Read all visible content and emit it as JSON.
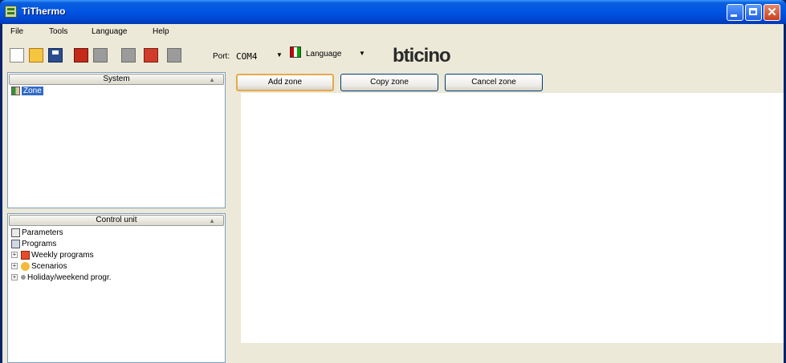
{
  "window": {
    "title": "TiThermo"
  },
  "menu": {
    "items": [
      "File",
      "Tools",
      "Language",
      "Help"
    ]
  },
  "toolbar": {
    "port_label": "Port:",
    "port_value": "COM4",
    "language_label": "Language",
    "brand": "bticino"
  },
  "system_panel": {
    "header": "System",
    "items": [
      "Zone"
    ]
  },
  "control_panel": {
    "header": "Control unit",
    "items": {
      "parameters": "Parameters",
      "programs": "Programs",
      "weekly": "Weekly programs",
      "scenarios": "Scenarios",
      "holiday": "Holiday/weekend progr."
    }
  },
  "actions": {
    "add_zone": "Add zone",
    "copy_zone": "Copy zone",
    "cancel_zone": "Cancel zone"
  },
  "icons": {
    "app": "thermostat-app-icon",
    "minimize": "minimize-icon",
    "maximize": "maximize-icon",
    "close": "close-icon"
  },
  "colors": {
    "titlebar": "#0055e5",
    "selection": "#316ac5",
    "workspace": "#ece9d8"
  }
}
